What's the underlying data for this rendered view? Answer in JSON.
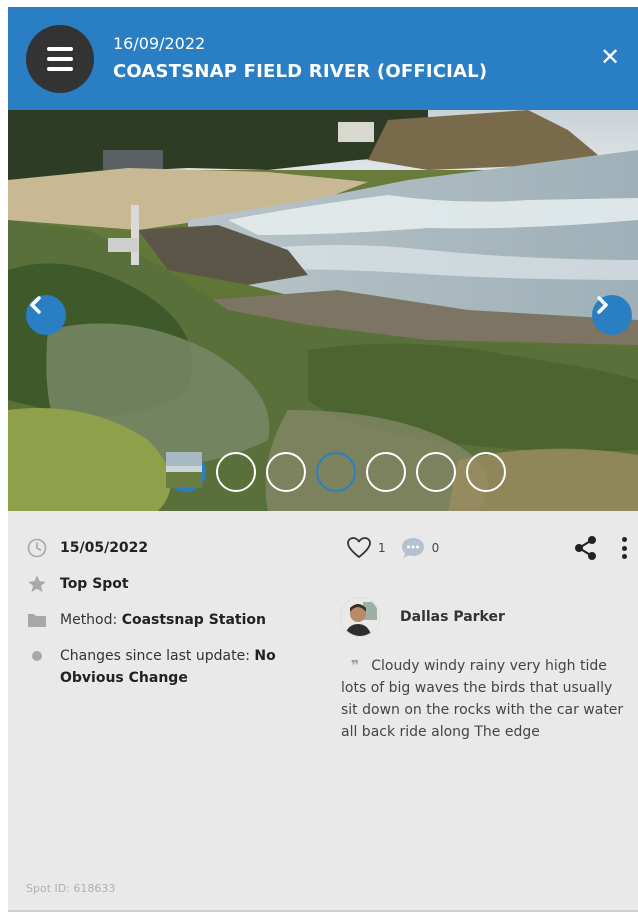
{
  "header": {
    "date": "16/09/2022",
    "title": "COASTSNAP FIELD RIVER (OFFICIAL)",
    "close_label": "✕"
  },
  "photo": {
    "add_label": "+",
    "thumbnail_count": 6
  },
  "details": {
    "date": "15/05/2022",
    "top_spot": "Top Spot",
    "method_label": "Method: ",
    "method_value": "Coastsnap Station",
    "changes_label": "Changes since last update: ",
    "changes_value": "No Obvious Change"
  },
  "social": {
    "likes": "1",
    "comments": "0"
  },
  "author": {
    "name": "Dallas Parker"
  },
  "comment": {
    "text": "Cloudy windy rainy very high tide lots of big waves the birds that usually sit down on the rocks with the car water all back ride along The edge"
  },
  "footer": {
    "spot_id": "Spot ID: 618633"
  },
  "colors": {
    "accent": "#2a7fc4",
    "menu_button": "#333333",
    "panel_bg": "#e9e9e9"
  },
  "icons": {
    "menu": "hamburger-icon",
    "close": "close-icon",
    "prev": "chevron-left-icon",
    "next": "chevron-right-icon",
    "add": "plus-icon",
    "date": "clock-icon",
    "top_spot": "star-icon",
    "method": "folder-icon",
    "changes": "dot-icon",
    "like": "heart-icon",
    "comment": "speech-bubble-icon",
    "share": "share-icon",
    "more": "more-vertical-icon"
  }
}
